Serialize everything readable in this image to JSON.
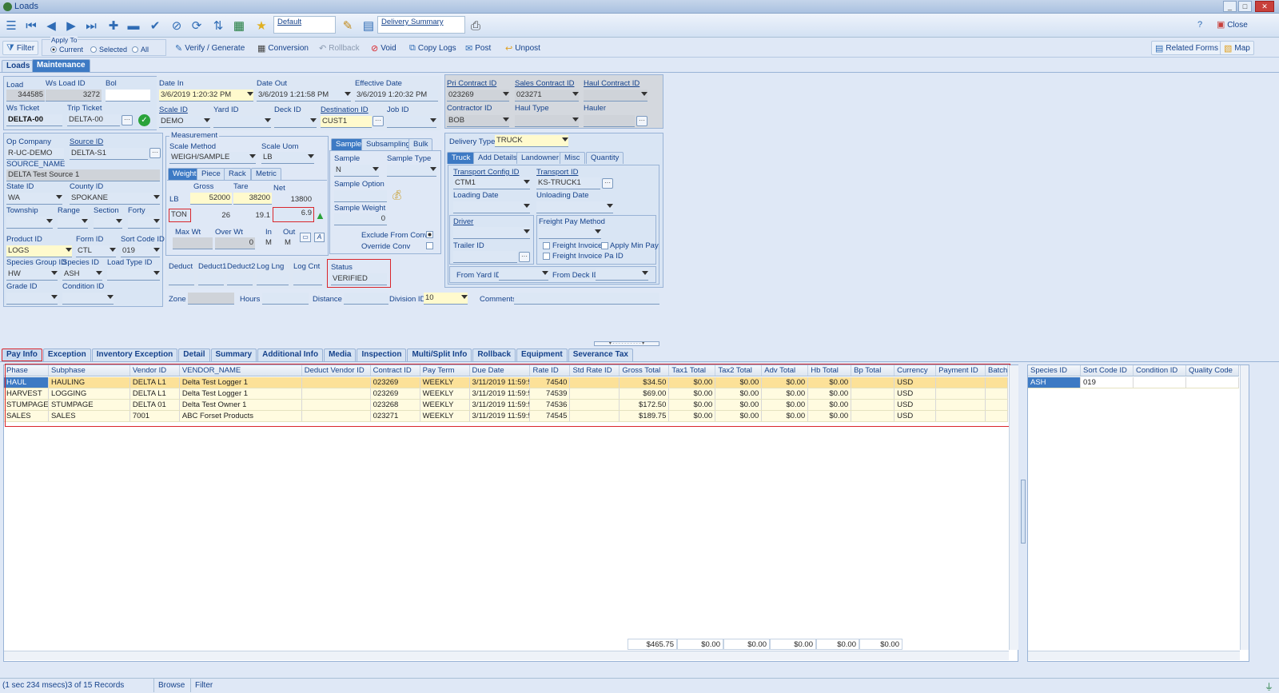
{
  "window": {
    "title": "Loads"
  },
  "toolbar": {
    "view_name": "Default",
    "report_name": "Delivery Summary"
  },
  "actionbar": {
    "filter": "Filter",
    "apply_to": "Apply To",
    "current": "Current",
    "selected": "Selected",
    "all": "All",
    "verify": "Verify / Generate",
    "conversion": "Conversion",
    "rollback": "Rollback",
    "void": "Void",
    "copy_logs": "Copy Logs",
    "post": "Post",
    "unpost": "Unpost",
    "related_forms": "Related Forms",
    "map": "Map",
    "help_close": "Close"
  },
  "main_tabs": [
    "Loads",
    "Maintenance"
  ],
  "load": {
    "load_lbl": "Load",
    "load": "344585",
    "ws_load_id_lbl": "Ws Load ID",
    "ws_load_id": "3272",
    "bol_lbl": "Bol",
    "bol": "",
    "ws_ticket_lbl": "Ws Ticket",
    "ws_ticket": "DELTA-00",
    "trip_ticket_lbl": "Trip Ticket",
    "trip_ticket": "DELTA-00",
    "date_in_lbl": "Date In",
    "date_in": "3/6/2019 1:20:32 PM",
    "date_out_lbl": "Date Out",
    "date_out": "3/6/2019 1:21:58 PM",
    "effective_date_lbl": "Effective Date",
    "effective_date": "3/6/2019 1:20:32 PM",
    "scale_id_lbl": "Scale ID",
    "scale_id": "DEMO",
    "yard_id_lbl": "Yard ID",
    "deck_id_lbl": "Deck ID",
    "destination_id_lbl": "Destination ID",
    "destination_id": "CUST1",
    "job_id_lbl": "Job ID",
    "pri_contract_lbl": "Pri Contract ID",
    "pri_contract": "023269",
    "sales_contract_lbl": "Sales Contract ID",
    "sales_contract": "023271",
    "haul_contract_lbl": "Haul Contract ID",
    "contractor_lbl": "Contractor ID",
    "contractor": "BOB",
    "haul_type_lbl": "Haul Type",
    "hauler_lbl": "Hauler"
  },
  "source": {
    "op_company_lbl": "Op Company",
    "op_company": "R-UC-DEMO",
    "source_id_lbl": "Source ID",
    "source_id": "DELTA-S1",
    "source_name_lbl": "SOURCE_NAME",
    "source_name": "DELTA Test Source 1",
    "state_lbl": "State ID",
    "state": "WA",
    "county_lbl": "County ID",
    "county": "SPOKANE",
    "township_lbl": "Township",
    "range_lbl": "Range",
    "section_lbl": "Section",
    "forty_lbl": "Forty",
    "product_lbl": "Product ID",
    "product": "LOGS",
    "form_lbl": "Form ID",
    "form": "CTL",
    "sort_code_lbl": "Sort Code ID",
    "sort_code": "019",
    "species_group_lbl": "Species Group ID",
    "species_group": "HW",
    "species_lbl": "Species ID",
    "species": "ASH",
    "load_type_lbl": "Load Type ID",
    "grade_lbl": "Grade ID",
    "condition_lbl": "Condition ID"
  },
  "measurement": {
    "legend": "Measurement",
    "scale_method_lbl": "Scale Method",
    "scale_method": "WEIGH/SAMPLE",
    "scale_uom_lbl": "Scale Uom",
    "scale_uom": "LB",
    "tabs": [
      "Weight",
      "Piece",
      "Rack",
      "Metric"
    ],
    "gross_lbl": "Gross",
    "tare_lbl": "Tare",
    "net_lbl": "Net",
    "unit1": "LB",
    "gross": "52000",
    "tare": "38200",
    "net": "13800",
    "unit2": "TON",
    "gross2": "26",
    "tare2": "19.1",
    "net2": "6.9",
    "max_wt_lbl": "Max Wt",
    "over_wt_lbl": "Over Wt",
    "over_wt": "0",
    "in_lbl": "In",
    "out_lbl": "Out",
    "in": "M",
    "out": "M",
    "deduct_lbl": "Deduct",
    "deduct1_lbl": "Deduct1",
    "deduct2_lbl": "Deduct2",
    "log_lng_lbl": "Log Lng",
    "log_cnt_lbl": "Log Cnt",
    "status_lbl": "Status",
    "status": "VERIFIED",
    "zone_lbl": "Zone",
    "hours_lbl": "Hours",
    "distance_lbl": "Distance",
    "division_lbl": "Division ID",
    "division": "10",
    "comments_lbl": "Comments"
  },
  "sample": {
    "tabs": [
      "Sample",
      "Subsampling",
      "Bulk"
    ],
    "sample_lbl": "Sample",
    "sample": "N",
    "sample_type_lbl": "Sample Type",
    "option_lbl": "Sample Option",
    "weight_lbl": "Sample Weight",
    "weight": "0",
    "exclude_lbl": "Exclude From Conv",
    "override_lbl": "Override Conv"
  },
  "delivery": {
    "type_lbl": "Delivery Type",
    "type": "TRUCK",
    "tabs": [
      "Truck",
      "Add Details",
      "Landowner",
      "Misc",
      "Quantity"
    ],
    "transport_config_lbl": "Transport Config ID",
    "transport_config": "CTM1",
    "transport_id_lbl": "Transport ID",
    "transport_id": "KS-TRUCK1",
    "loading_date_lbl": "Loading Date",
    "unloading_date_lbl": "Unloading Date",
    "driver_lbl": "Driver",
    "trailer_lbl": "Trailer ID",
    "freight_pay_lbl": "Freight Pay Method",
    "freight_invoice_lbl": "Freight Invoice",
    "apply_min_pay_lbl": "Apply Min Pay",
    "freight_invoice_pa_lbl": "Freight Invoice Pa ID",
    "from_yard_lbl": "From Yard ID",
    "from_deck_lbl": "From Deck ID"
  },
  "bottom_tabs": [
    "Pay Info",
    "Exception",
    "Inventory Exception",
    "Detail",
    "Summary",
    "Additional Info",
    "Media",
    "Inspection",
    "Multi/Split Info",
    "Rollback",
    "Equipment",
    "Severance Tax"
  ],
  "pay_grid": {
    "columns": [
      "Phase",
      "Subphase",
      "Vendor ID",
      "VENDOR_NAME",
      "Deduct Vendor ID",
      "Contract ID",
      "Pay Term",
      "Due Date",
      "Rate ID",
      "Std Rate ID",
      "Gross Total",
      "Tax1 Total",
      "Tax2 Total",
      "Adv Total",
      "Hb Total",
      "Bp Total",
      "Currency",
      "Payment ID",
      "Batch"
    ],
    "rows": [
      [
        "HAUL",
        "HAULING",
        "DELTA L1",
        "Delta Test Logger 1",
        "",
        "023269",
        "WEEKLY",
        "3/11/2019 11:59:5",
        "74540",
        "",
        "$34.50",
        "$0.00",
        "$0.00",
        "$0.00",
        "$0.00",
        "",
        "USD",
        "",
        ""
      ],
      [
        "HARVEST",
        "LOGGING",
        "DELTA L1",
        "Delta Test Logger 1",
        "",
        "023269",
        "WEEKLY",
        "3/11/2019 11:59:5",
        "74539",
        "",
        "$69.00",
        "$0.00",
        "$0.00",
        "$0.00",
        "$0.00",
        "",
        "USD",
        "",
        ""
      ],
      [
        "STUMPAGE",
        "STUMPAGE",
        "DELTA 01",
        "Delta Test Owner 1",
        "",
        "023268",
        "WEEKLY",
        "3/11/2019 11:59:5",
        "74536",
        "",
        "$172.50",
        "$0.00",
        "$0.00",
        "$0.00",
        "$0.00",
        "",
        "USD",
        "",
        ""
      ],
      [
        "SALES",
        "SALES",
        "7001",
        "ABC Forset Products",
        "",
        "023271",
        "WEEKLY",
        "3/11/2019 11:59:5",
        "74545",
        "",
        "$189.75",
        "$0.00",
        "$0.00",
        "$0.00",
        "$0.00",
        "",
        "USD",
        "",
        ""
      ]
    ],
    "totals": [
      "$465.75",
      "$0.00",
      "$0.00",
      "$0.00",
      "$0.00",
      "$0.00"
    ]
  },
  "species_grid": {
    "columns": [
      "Species ID",
      "Sort Code ID",
      "Condition ID",
      "Quality Code"
    ],
    "rows": [
      [
        "ASH",
        "019",
        "",
        ""
      ]
    ]
  },
  "status": {
    "records": "(1 sec 234 msecs)3 of 15 Records",
    "mode": "Browse",
    "filter": "Filter"
  }
}
